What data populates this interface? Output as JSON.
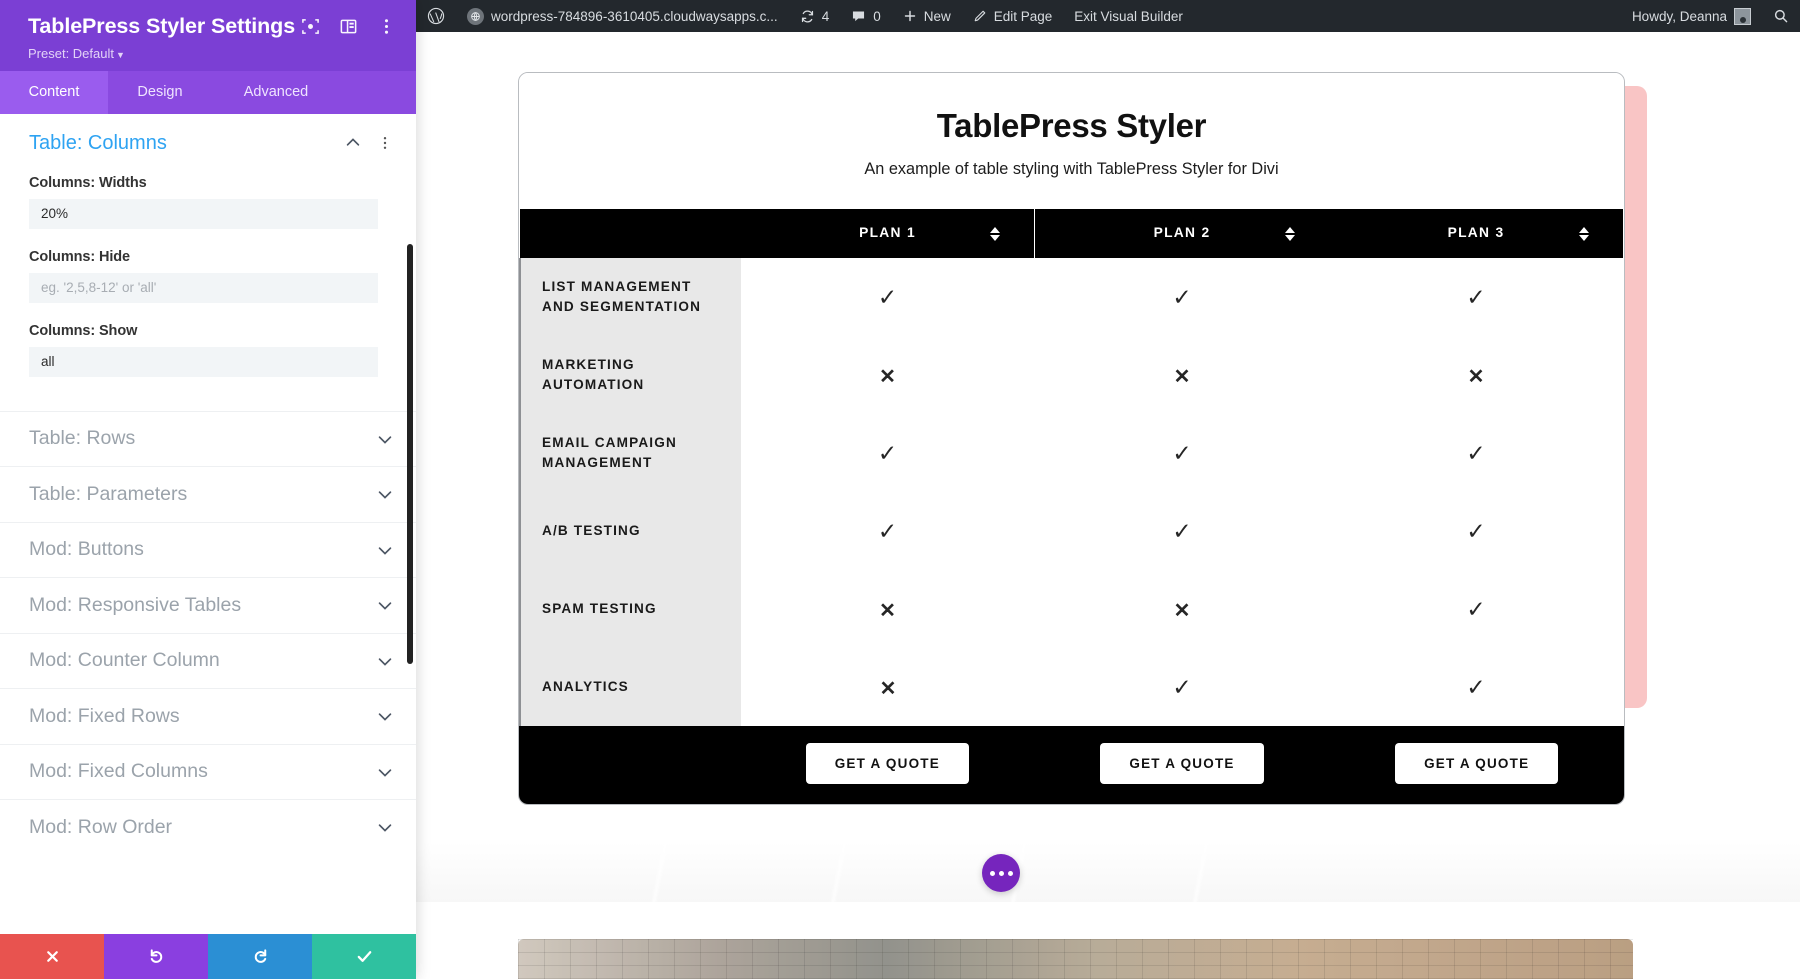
{
  "settings_panel": {
    "title": "TablePress Styler Settings",
    "preset_label": "Preset: Default",
    "header_icons": [
      "target-icon",
      "layout-toggle-icon",
      "more-vertical-icon"
    ],
    "tabs": [
      {
        "label": "Content",
        "active": true
      },
      {
        "label": "Design",
        "active": false
      },
      {
        "label": "Advanced",
        "active": false
      }
    ],
    "open_section": {
      "title": "Table: Columns",
      "fields": [
        {
          "label": "Columns: Widths",
          "value": "20%",
          "placeholder": "",
          "is_placeholder": false
        },
        {
          "label": "Columns: Hide",
          "value": "eg. '2,5,8-12' or 'all'",
          "placeholder": "eg. '2,5,8-12' or 'all'",
          "is_placeholder": true
        },
        {
          "label": "Columns: Show",
          "value": "all",
          "placeholder": "",
          "is_placeholder": false
        }
      ]
    },
    "sections": [
      {
        "label": "Table: Rows"
      },
      {
        "label": "Table: Parameters"
      },
      {
        "label": "Mod: Buttons"
      },
      {
        "label": "Mod: Responsive Tables"
      },
      {
        "label": "Mod: Counter Column"
      },
      {
        "label": "Mod: Fixed Rows"
      },
      {
        "label": "Mod: Fixed Columns"
      },
      {
        "label": "Mod: Row Order"
      }
    ],
    "actions": [
      {
        "name": "cancel",
        "icon": "close-icon",
        "color": "#e8534f"
      },
      {
        "name": "undo",
        "icon": "undo-icon",
        "color": "#8a3fe0"
      },
      {
        "name": "redo",
        "icon": "redo-icon",
        "color": "#2b8fd4"
      },
      {
        "name": "save",
        "icon": "check-icon",
        "color": "#2fc1a0"
      }
    ]
  },
  "adminbar": {
    "site_name": "wordpress-784896-3610405.cloudwaysapps.c...",
    "updates_count": "4",
    "comments_count": "0",
    "new_label": "New",
    "edit_page_label": "Edit Page",
    "exit_builder_label": "Exit Visual Builder",
    "howdy": "Howdy, Deanna"
  },
  "table": {
    "title": "TablePress Styler",
    "subtitle": "An example of table styling with TablePress Styler for Divi",
    "columns": [
      "",
      "PLAN 1",
      "PLAN 2",
      "PLAN 3"
    ],
    "rows": [
      {
        "feature": "LIST MANAGEMENT AND SEGMENTATION",
        "values": [
          "yes",
          "yes",
          "yes"
        ]
      },
      {
        "feature": "MARKETING AUTOMATION",
        "values": [
          "no",
          "no",
          "no"
        ]
      },
      {
        "feature": "EMAIL CAMPAIGN MANAGEMENT",
        "values": [
          "yes",
          "yes",
          "yes"
        ]
      },
      {
        "feature": "A/B TESTING",
        "values": [
          "yes",
          "yes",
          "yes"
        ]
      },
      {
        "feature": "SPAM TESTING",
        "values": [
          "no",
          "no",
          "yes"
        ]
      },
      {
        "feature": "ANALYTICS",
        "values": [
          "no",
          "yes",
          "yes"
        ]
      }
    ],
    "footer_buttons": [
      "GET A QUOTE",
      "GET A QUOTE",
      "GET A QUOTE"
    ]
  },
  "colors": {
    "panel_purple": "#7b3fd4",
    "tab_purple": "#8a4ae0",
    "accent_blue": "#2ea3f2",
    "table_black": "#000000",
    "feature_gray": "#e8e8e8",
    "shadow_pink": "#f9c5c5",
    "fab_purple": "#7625bd",
    "adminbar_dark": "#23282d"
  }
}
